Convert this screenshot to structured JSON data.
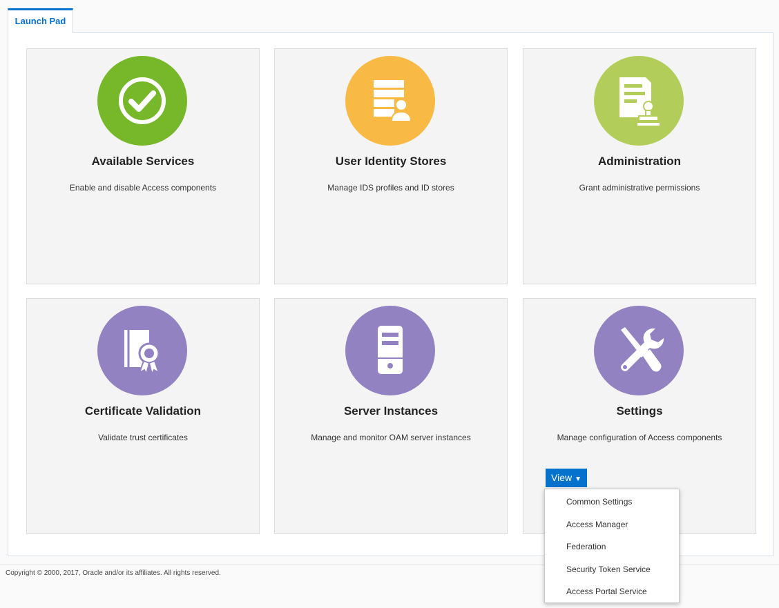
{
  "tab": {
    "label": "Launch Pad"
  },
  "cards": [
    {
      "title": "Available Services",
      "description": "Enable and disable Access components",
      "icon": "check-icon",
      "color": "#77b82a"
    },
    {
      "title": "User Identity Stores",
      "description": "Manage IDS profiles and ID stores",
      "icon": "identity-store-icon",
      "color": "#f8b945"
    },
    {
      "title": "Administration",
      "description": "Grant administrative permissions",
      "icon": "document-stamp-icon",
      "color": "#b3cd5a"
    },
    {
      "title": "Certificate Validation",
      "description": "Validate trust certificates",
      "icon": "certificate-icon",
      "color": "#9282c2"
    },
    {
      "title": "Server Instances",
      "description": "Manage and monitor OAM server instances",
      "icon": "server-icon",
      "color": "#9282c2"
    },
    {
      "title": "Settings",
      "description": "Manage configuration of Access components",
      "icon": "tools-icon",
      "color": "#9282c2"
    }
  ],
  "settings_view": {
    "button_label": "View",
    "menu_items": [
      "Common Settings",
      "Access Manager",
      "Federation",
      "Security Token Service",
      "Access Portal Service"
    ]
  },
  "footer": {
    "copyright": "Copyright © 2000, 2017, Oracle and/or its affiliates. All rights reserved."
  },
  "colors": {
    "accent": "#0572ce"
  }
}
